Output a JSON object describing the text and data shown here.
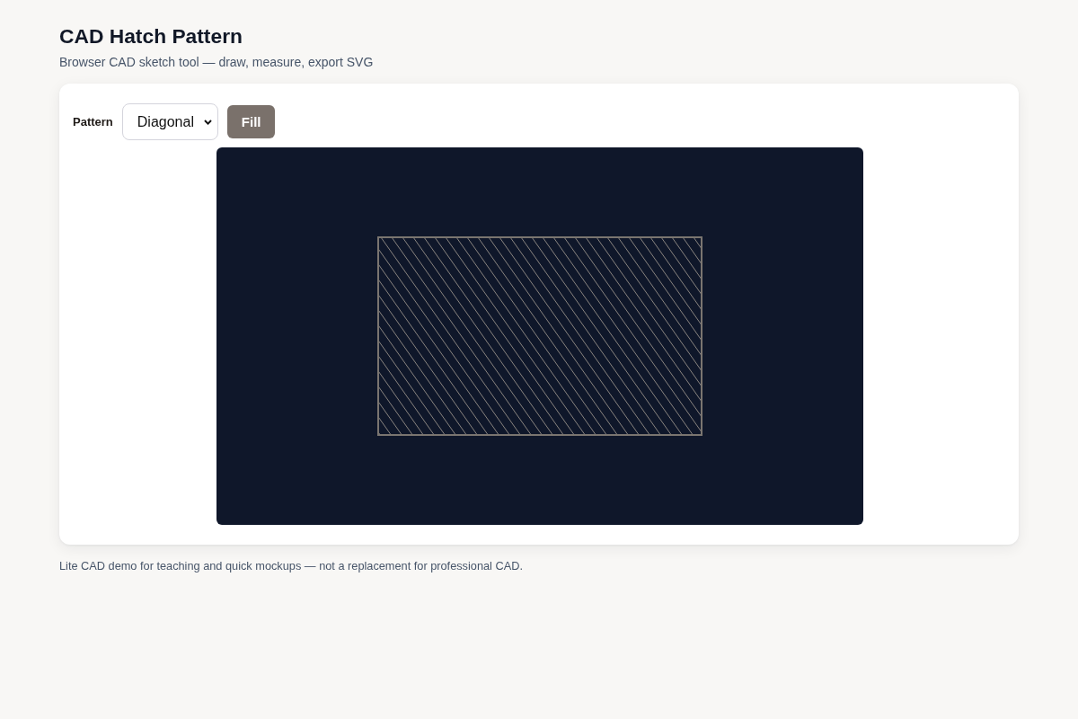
{
  "header": {
    "title": "CAD Hatch Pattern",
    "subtitle": "Browser CAD sketch tool — draw, measure, export SVG"
  },
  "toolbar": {
    "pattern_label": "Pattern",
    "pattern_select": {
      "value": "Diagonal"
    },
    "fill_button": "Fill"
  },
  "canvas": {
    "shapes": [
      {
        "kind": "rectangle",
        "hatched": true
      }
    ]
  },
  "footer": "Lite CAD demo for teaching and quick mockups — not a replacement for professional CAD."
}
